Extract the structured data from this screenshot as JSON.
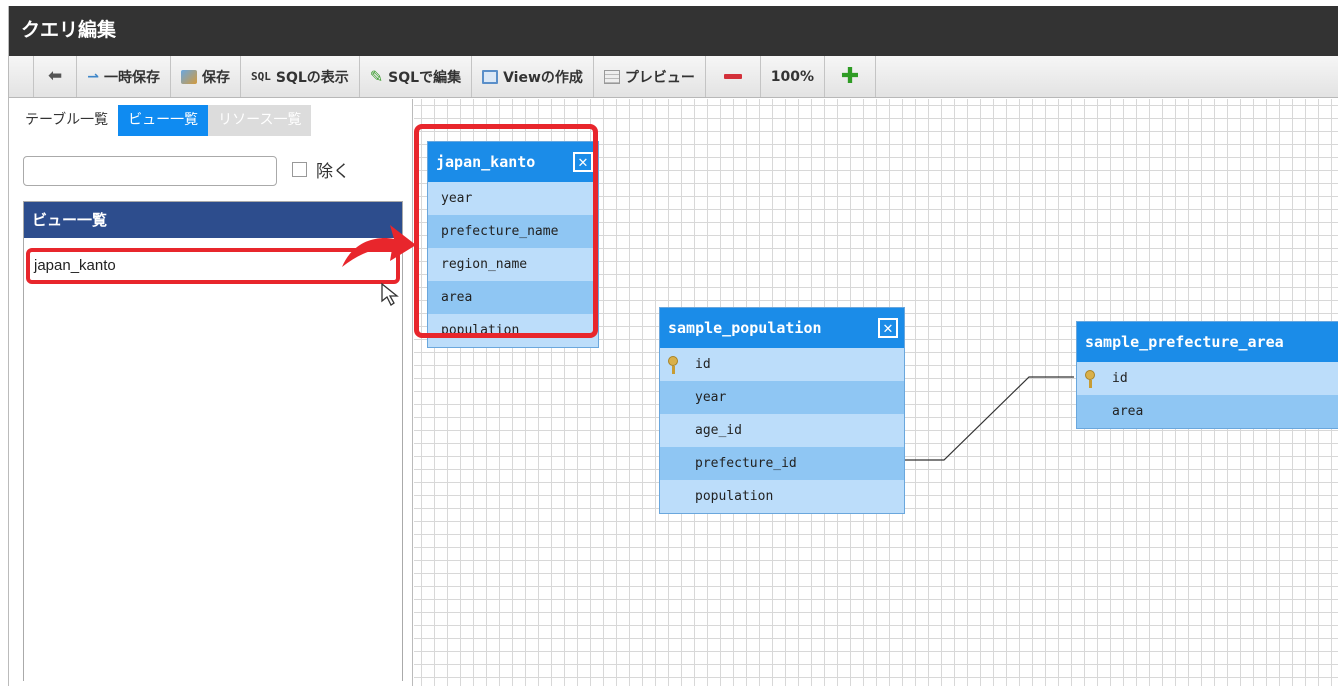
{
  "window": {
    "title": "クエリ編集"
  },
  "toolbar": {
    "back_label": "",
    "temp_save_label": "一時保存",
    "save_label": "保存",
    "sql_show_label": "SQLの表示",
    "sql_show_prefix": "SQL",
    "sql_edit_label": "SQLで編集",
    "view_create_label": "Viewの作成",
    "preview_label": "プレビュー",
    "zoom": "100%"
  },
  "sidebar": {
    "tabs": [
      {
        "label": "テーブル一覧",
        "state": "normal"
      },
      {
        "label": "ビュー一覧",
        "state": "active"
      },
      {
        "label": "リソース一覧",
        "state": "disabled"
      }
    ],
    "search": {
      "value": "",
      "placeholder": ""
    },
    "exclude_label": "除く",
    "list_header": "ビュー一覧",
    "items": [
      {
        "label": "japan_kanto"
      }
    ]
  },
  "tables": [
    {
      "name": "japan_kanto",
      "close": "✕",
      "columns": [
        "year",
        "prefecture_name",
        "region_name",
        "area",
        "population"
      ]
    },
    {
      "name": "sample_population",
      "close": "✕",
      "columns": [
        "id",
        "year",
        "age_id",
        "prefecture_id",
        "population"
      ],
      "key": "id"
    },
    {
      "name": "sample_prefecture_area",
      "close": "✕",
      "columns": [
        "id",
        "area"
      ],
      "key": "id"
    }
  ],
  "colors": {
    "titlebar": "#333333",
    "accent": "#1b8ce8",
    "header": "#2d4d8d",
    "highlight": "#e8262c"
  }
}
